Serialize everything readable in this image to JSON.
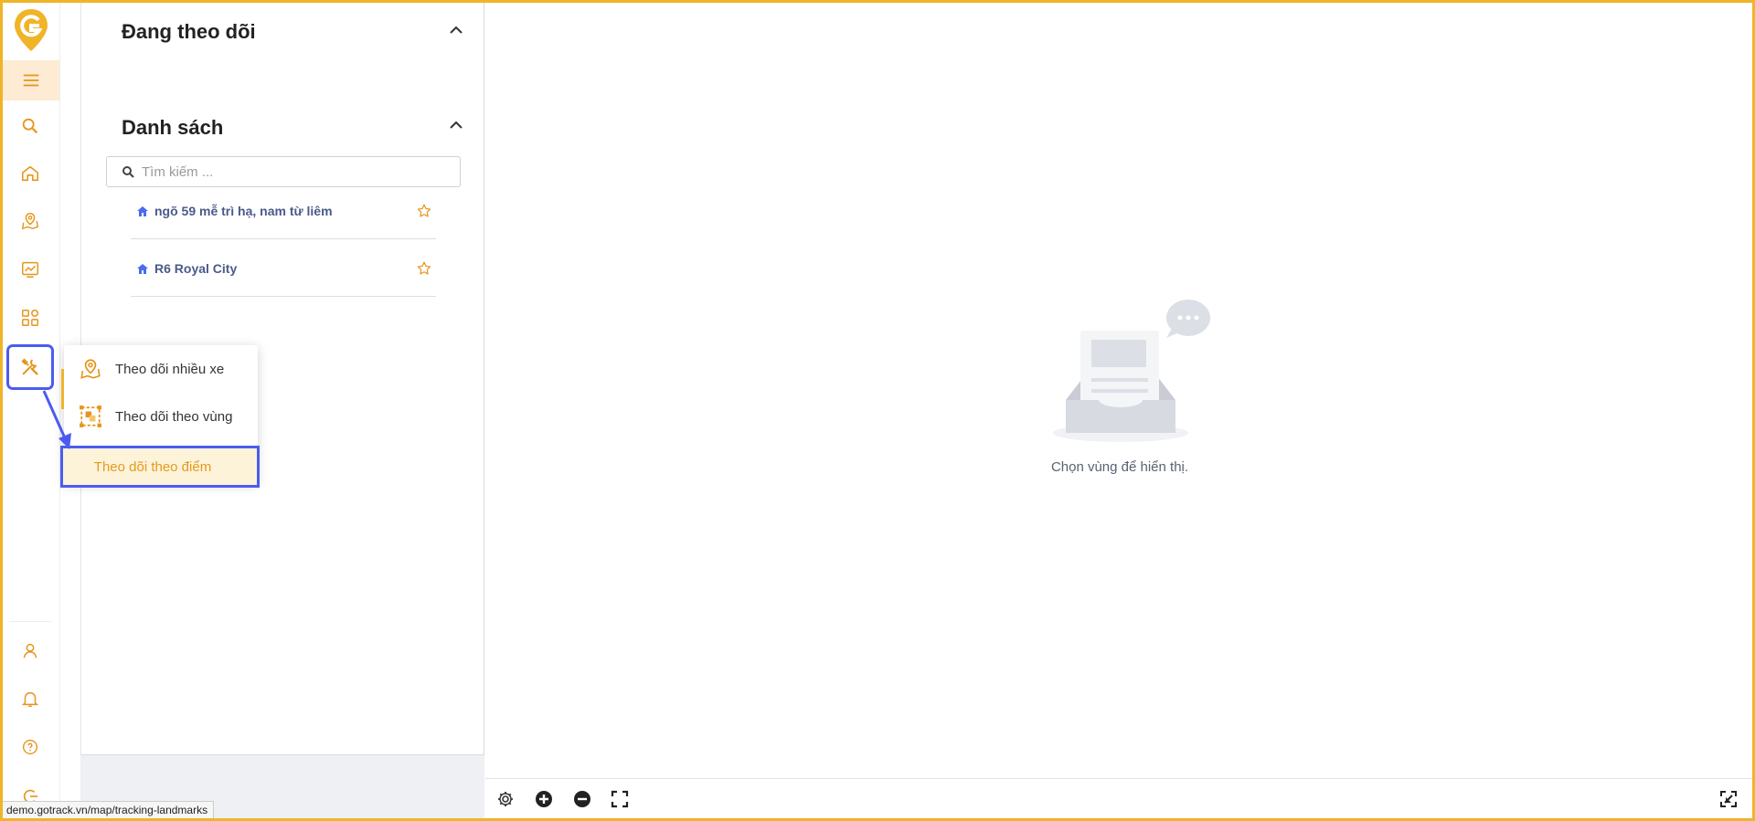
{
  "colors": {
    "accent": "#f0b429",
    "icon": "#e5951b",
    "highlight": "#4a5cf0",
    "item_text": "#4a5a8a"
  },
  "rail": {
    "icons": [
      "logo-g-icon",
      "hamburger-icon",
      "search-icon",
      "home-icon",
      "map-pin-icon",
      "chart-icon",
      "apps-icon",
      "tools-icon",
      "user-icon",
      "bell-icon",
      "help-icon",
      "logout-icon"
    ]
  },
  "panel": {
    "following_title": "Đang theo dõi",
    "list_title": "Danh sách",
    "search_placeholder": "Tìm kiếm ...",
    "items": [
      {
        "label": "ngõ 59 mễ trì hạ, nam từ liêm"
      },
      {
        "label": "R6 Royal City"
      }
    ]
  },
  "popup": {
    "items": [
      {
        "label": "Theo dõi nhiều xe",
        "icon": "map-pin-icon"
      },
      {
        "label": "Theo dõi theo vùng",
        "icon": "region-icon"
      },
      {
        "label": "Theo dõi theo điểm"
      }
    ]
  },
  "map": {
    "empty_text": "Chọn vùng để hiển thị."
  },
  "toolbar": {
    "icons": [
      "settings-icon",
      "zoom-in-icon",
      "zoom-out-icon",
      "fullscreen-icon",
      "collapse-icon"
    ]
  },
  "status_url": "demo.gotrack.vn/map/tracking-landmarks"
}
